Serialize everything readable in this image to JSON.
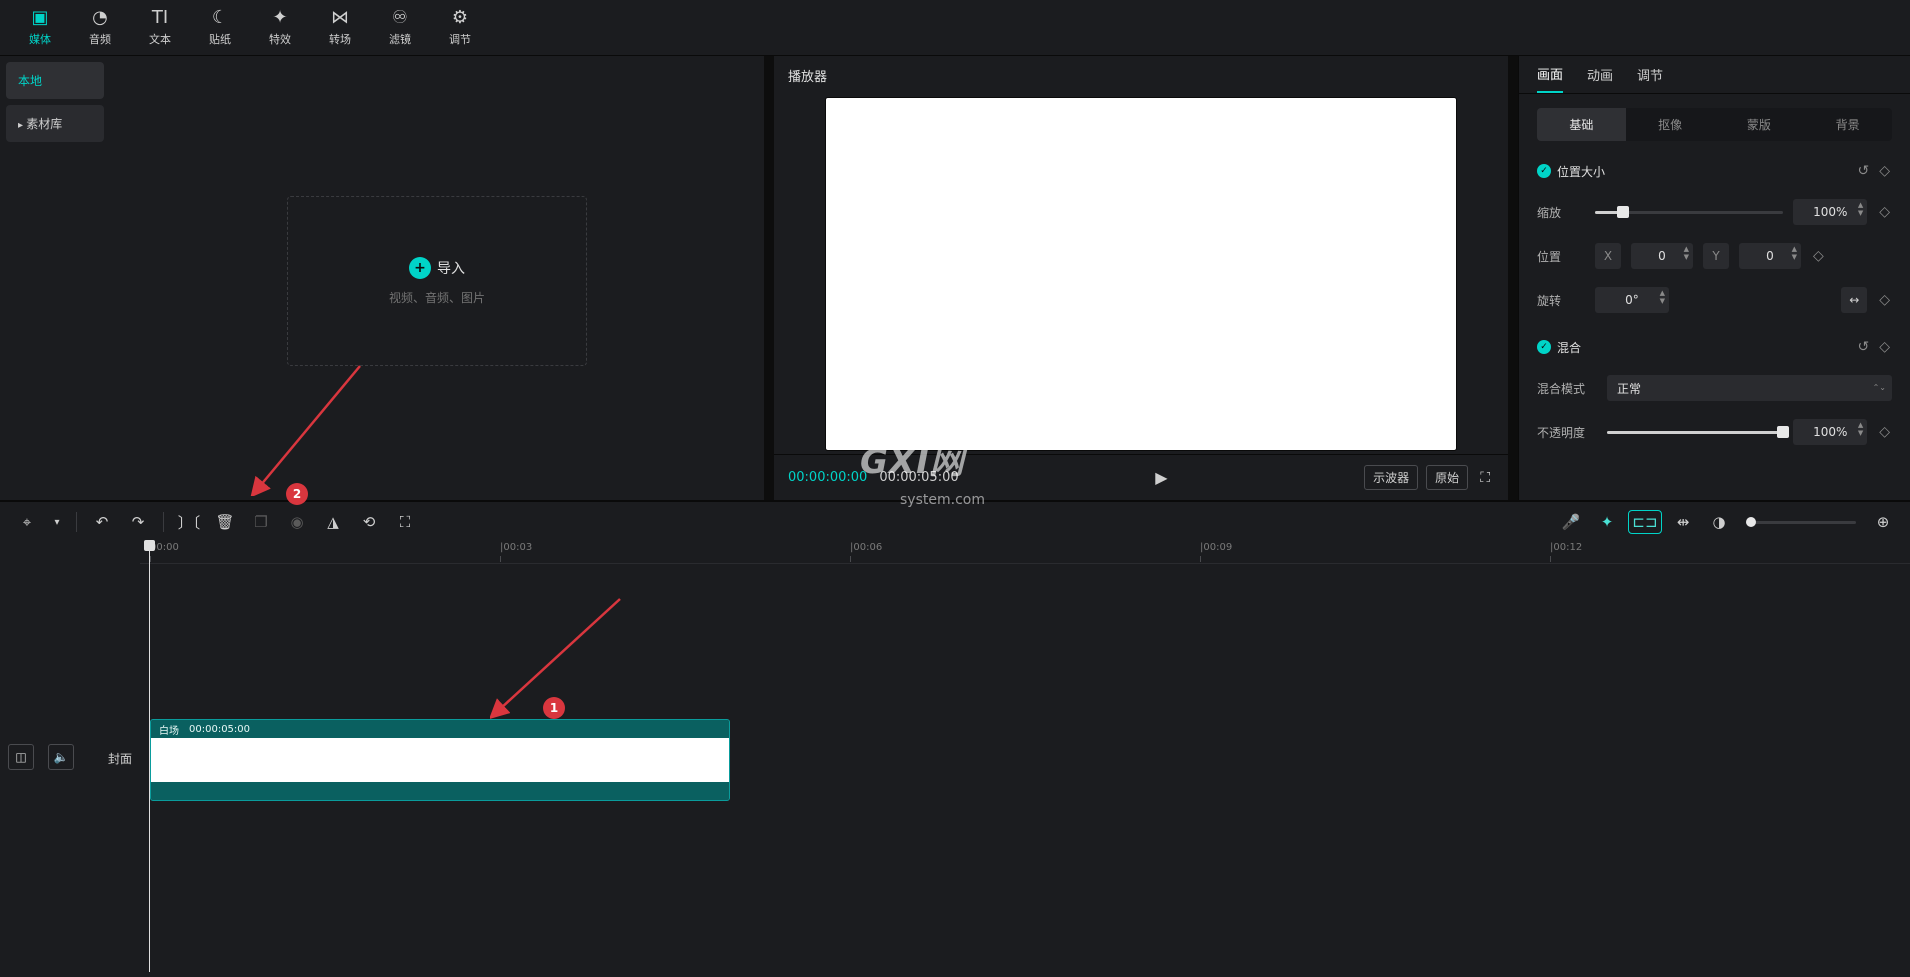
{
  "top_tabs": {
    "media": "媒体",
    "audio": "音频",
    "text": "文本",
    "sticker": "贴纸",
    "effect": "特效",
    "transition": "转场",
    "filter": "滤镜",
    "adjust": "调节"
  },
  "left_sidebar": {
    "local": "本地",
    "library": "素材库"
  },
  "import_box": {
    "label": "导入",
    "hint": "视频、音频、图片"
  },
  "player": {
    "title": "播放器",
    "time_current": "00:00:00:00",
    "time_total": "00:00:05:00",
    "scope_btn": "示波器",
    "ratio_btn": "原始"
  },
  "inspector": {
    "tabs": {
      "canvas": "画面",
      "animation": "动画",
      "adjust": "调节"
    },
    "subtabs": {
      "basic": "基础",
      "cutout": "抠像",
      "mask": "蒙版",
      "background": "背景"
    },
    "section_position": "位置大小",
    "scale_label": "缩放",
    "scale_value": "100%",
    "position_label": "位置",
    "pos_x_axis": "X",
    "pos_x": "0",
    "pos_y_axis": "Y",
    "pos_y": "0",
    "rotation_label": "旋转",
    "rotation_value": "0°",
    "section_blend": "混合",
    "blend_mode_label": "混合模式",
    "blend_mode_value": "正常",
    "opacity_label": "不透明度",
    "opacity_value": "100%"
  },
  "timeline": {
    "ruler": [
      "00:00",
      "|00:03",
      "|00:06",
      "|00:09",
      "|00:12"
    ],
    "cover_label": "封面",
    "clip_name": "白场",
    "clip_duration": "00:00:05:00"
  },
  "annotations": {
    "badge1": "1",
    "badge2": "2"
  },
  "watermark": {
    "main": "GXI网",
    "sub": "system.com"
  }
}
